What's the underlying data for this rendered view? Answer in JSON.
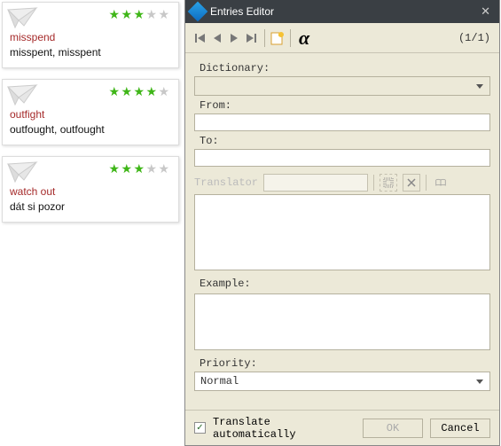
{
  "cards": [
    {
      "title": "misspend",
      "sub": "misspent, misspent",
      "stars": 3
    },
    {
      "title": "outfight",
      "sub": "outfought, outfought",
      "stars": 4
    },
    {
      "title": "watch out",
      "sub": "dát si pozor",
      "stars": 3
    }
  ],
  "editor": {
    "window_title": "Entries Editor",
    "page_indicator": "(1/1)",
    "labels": {
      "dictionary": "Dictionary:",
      "from": "From:",
      "to": "To:",
      "translator": "Translator",
      "example": "Example:",
      "priority": "Priority:"
    },
    "fields": {
      "dictionary": "",
      "from": "",
      "to": "",
      "translator_input": "",
      "translation_text": "",
      "example_text": ""
    },
    "priority_value": "Normal",
    "translate_auto_label": "Translate automatically",
    "translate_auto_checked": true,
    "buttons": {
      "ok": "OK",
      "cancel": "Cancel"
    }
  },
  "icons": {
    "paper_plane": "paper-plane",
    "nav_first": "nav-first",
    "nav_prev": "nav-prev",
    "nav_next": "nav-next",
    "nav_last": "nav-last",
    "new_doc": "new-doc",
    "alpha": "α",
    "grid": "grid",
    "delete": "delete",
    "book": "book",
    "close": "✕",
    "check": "✓"
  },
  "star_max": 5
}
